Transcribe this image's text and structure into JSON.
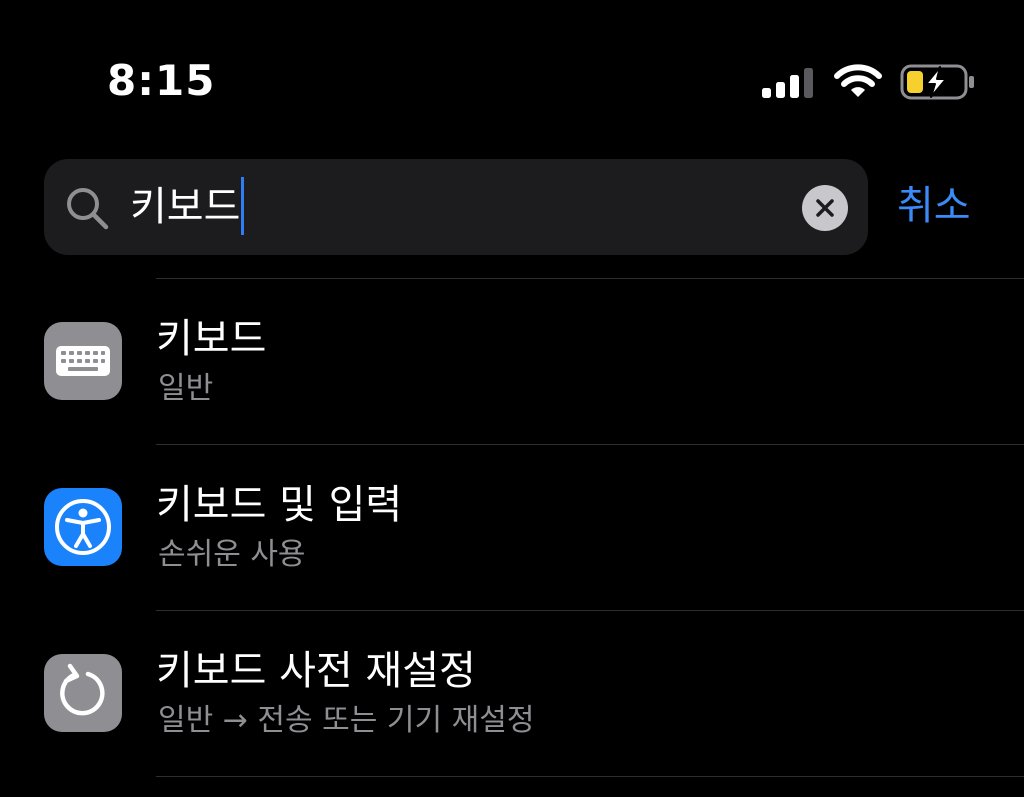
{
  "status_bar": {
    "time": "8:15",
    "icons": [
      "cellular-signal-icon",
      "wifi-icon",
      "battery-charging-icon"
    ],
    "battery_color": "#f5d02f"
  },
  "search": {
    "query": "키보드",
    "cancel_label": "취소",
    "accent_color": "#3a8bf7"
  },
  "results": [
    {
      "title": "키보드",
      "subtitle": "일반",
      "icon": "keyboard-icon",
      "icon_bg": "#8e8e93"
    },
    {
      "title": "키보드 및 입력",
      "subtitle": "손쉬운 사용",
      "icon": "accessibility-icon",
      "icon_bg": "#1a82fb"
    },
    {
      "title": "키보드 사전 재설정",
      "subtitle": "일반 → 전송 또는 기기 재설정",
      "icon": "reset-arrow-icon",
      "icon_bg": "#8e8e93"
    }
  ]
}
